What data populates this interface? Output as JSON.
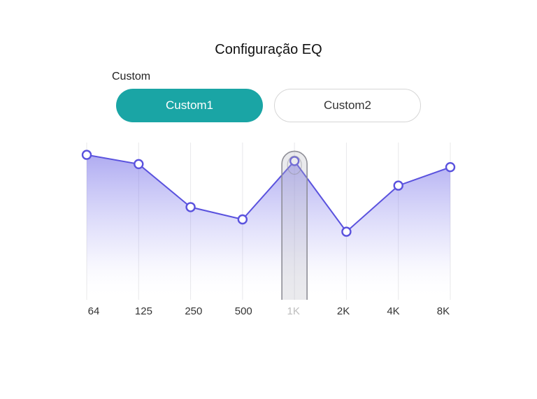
{
  "title": "Configuração EQ",
  "subtitle": "Custom",
  "tabs": {
    "custom1": "Custom1",
    "custom2": "Custom2"
  },
  "xaxis": [
    "64",
    "125",
    "250",
    "500",
    "1K",
    "2K",
    "4K",
    "8K"
  ],
  "chart_data": {
    "type": "line",
    "categories": [
      "64",
      "125",
      "250",
      "500",
      "1K",
      "2K",
      "4K",
      "8K"
    ],
    "values": [
      9.2,
      8.6,
      5.8,
      5.0,
      8.8,
      4.2,
      7.2,
      8.4
    ],
    "title": "Configuração EQ",
    "xlabel": "",
    "ylabel": "",
    "ylim": [
      0,
      10
    ],
    "highlight_index": 4
  }
}
